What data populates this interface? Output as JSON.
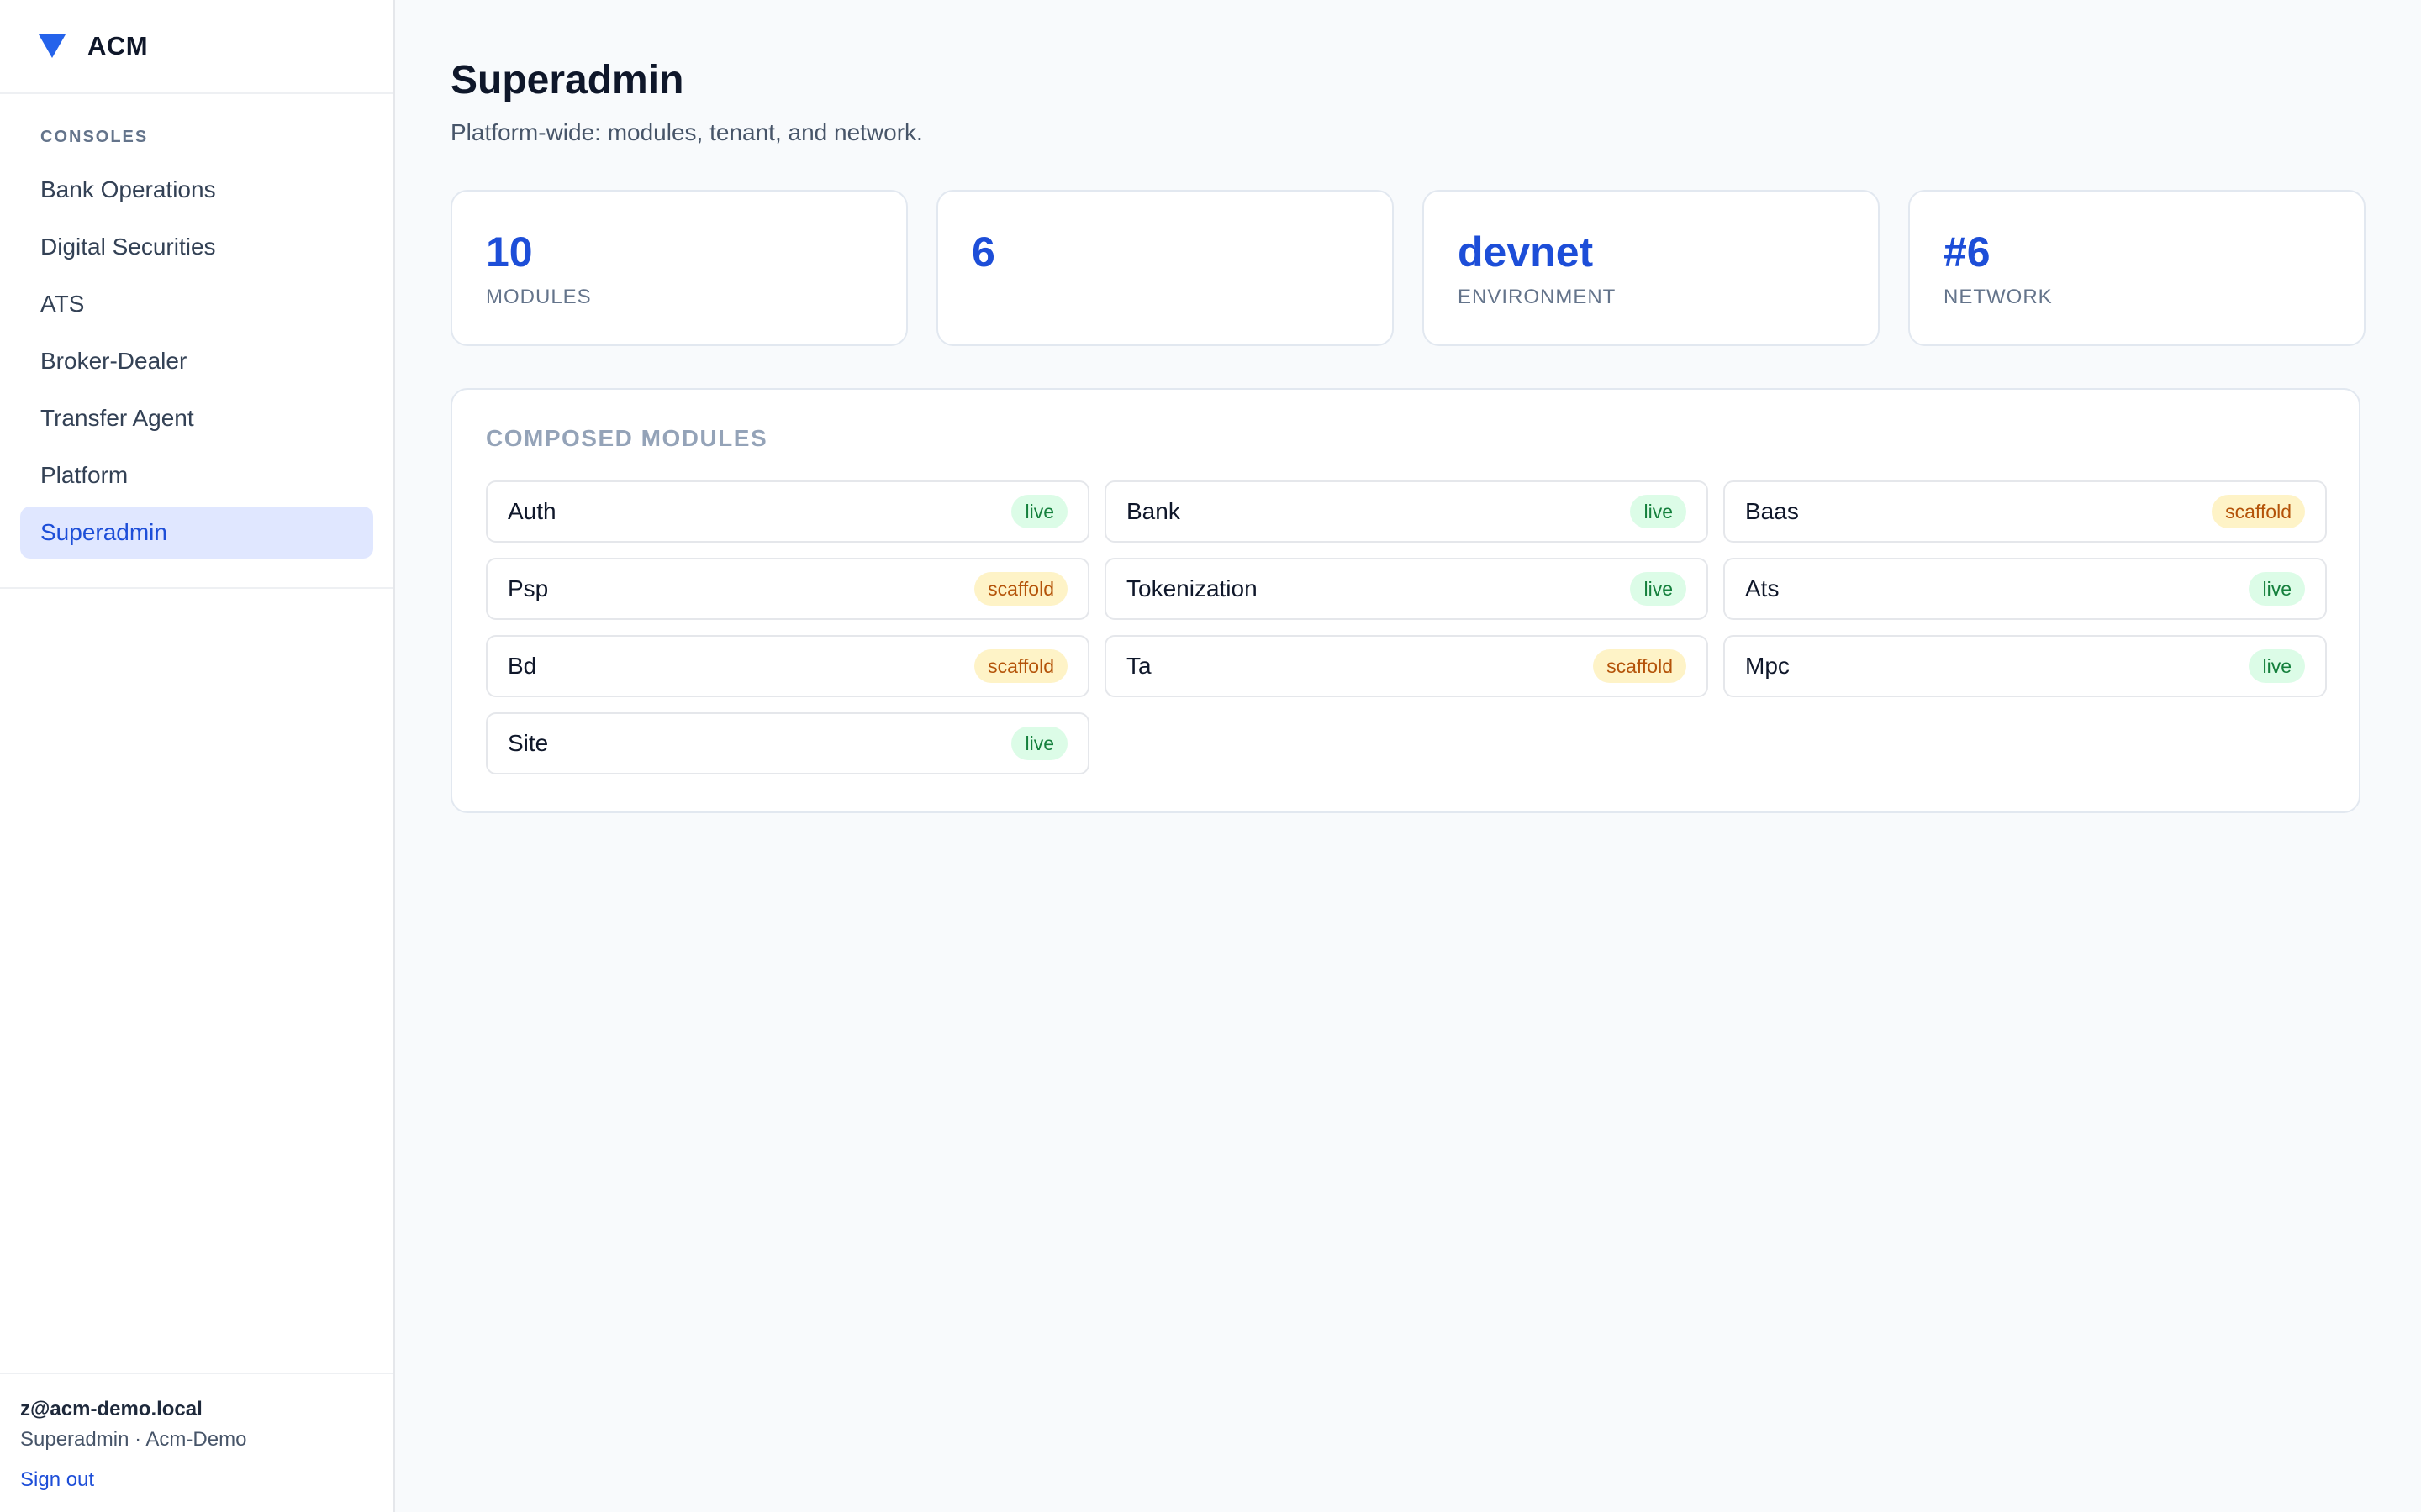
{
  "brand": {
    "name": "ACM",
    "logo_icon": "triangle-down-icon",
    "logo_color": "#2563eb"
  },
  "sidebar": {
    "section_label": "CONSOLES",
    "items": [
      {
        "label": "Bank Operations"
      },
      {
        "label": "Digital Securities"
      },
      {
        "label": "ATS"
      },
      {
        "label": "Broker-Dealer"
      },
      {
        "label": "Transfer Agent"
      },
      {
        "label": "Platform"
      },
      {
        "label": "Superadmin"
      }
    ],
    "active_index": 6
  },
  "user": {
    "email": "z@acm-demo.local",
    "role": "Superadmin · Acm-Demo",
    "signout_label": "Sign out"
  },
  "page": {
    "title": "Superadmin",
    "subtitle": "Platform-wide: modules, tenant, and network."
  },
  "stats": [
    {
      "value": "10",
      "label": "MODULES"
    },
    {
      "value": "6",
      "label": ""
    },
    {
      "value": "devnet",
      "label": "ENVIRONMENT"
    },
    {
      "value": "#6",
      "label": "NETWORK"
    }
  ],
  "modules": {
    "title": "COMPOSED MODULES",
    "items": [
      {
        "name": "Auth",
        "status": "live"
      },
      {
        "name": "Bank",
        "status": "live"
      },
      {
        "name": "Baas",
        "status": "scaffold"
      },
      {
        "name": "Psp",
        "status": "scaffold"
      },
      {
        "name": "Tokenization",
        "status": "live"
      },
      {
        "name": "Ats",
        "status": "live"
      },
      {
        "name": "Bd",
        "status": "scaffold"
      },
      {
        "name": "Ta",
        "status": "scaffold"
      },
      {
        "name": "Mpc",
        "status": "live"
      },
      {
        "name": "Site",
        "status": "live"
      }
    ]
  },
  "colors": {
    "accent": "#1d4ed8",
    "live_bg": "#dcfce7",
    "live_text": "#15803d",
    "scaffold_bg": "#fef3c7",
    "scaffold_text": "#b45309"
  }
}
